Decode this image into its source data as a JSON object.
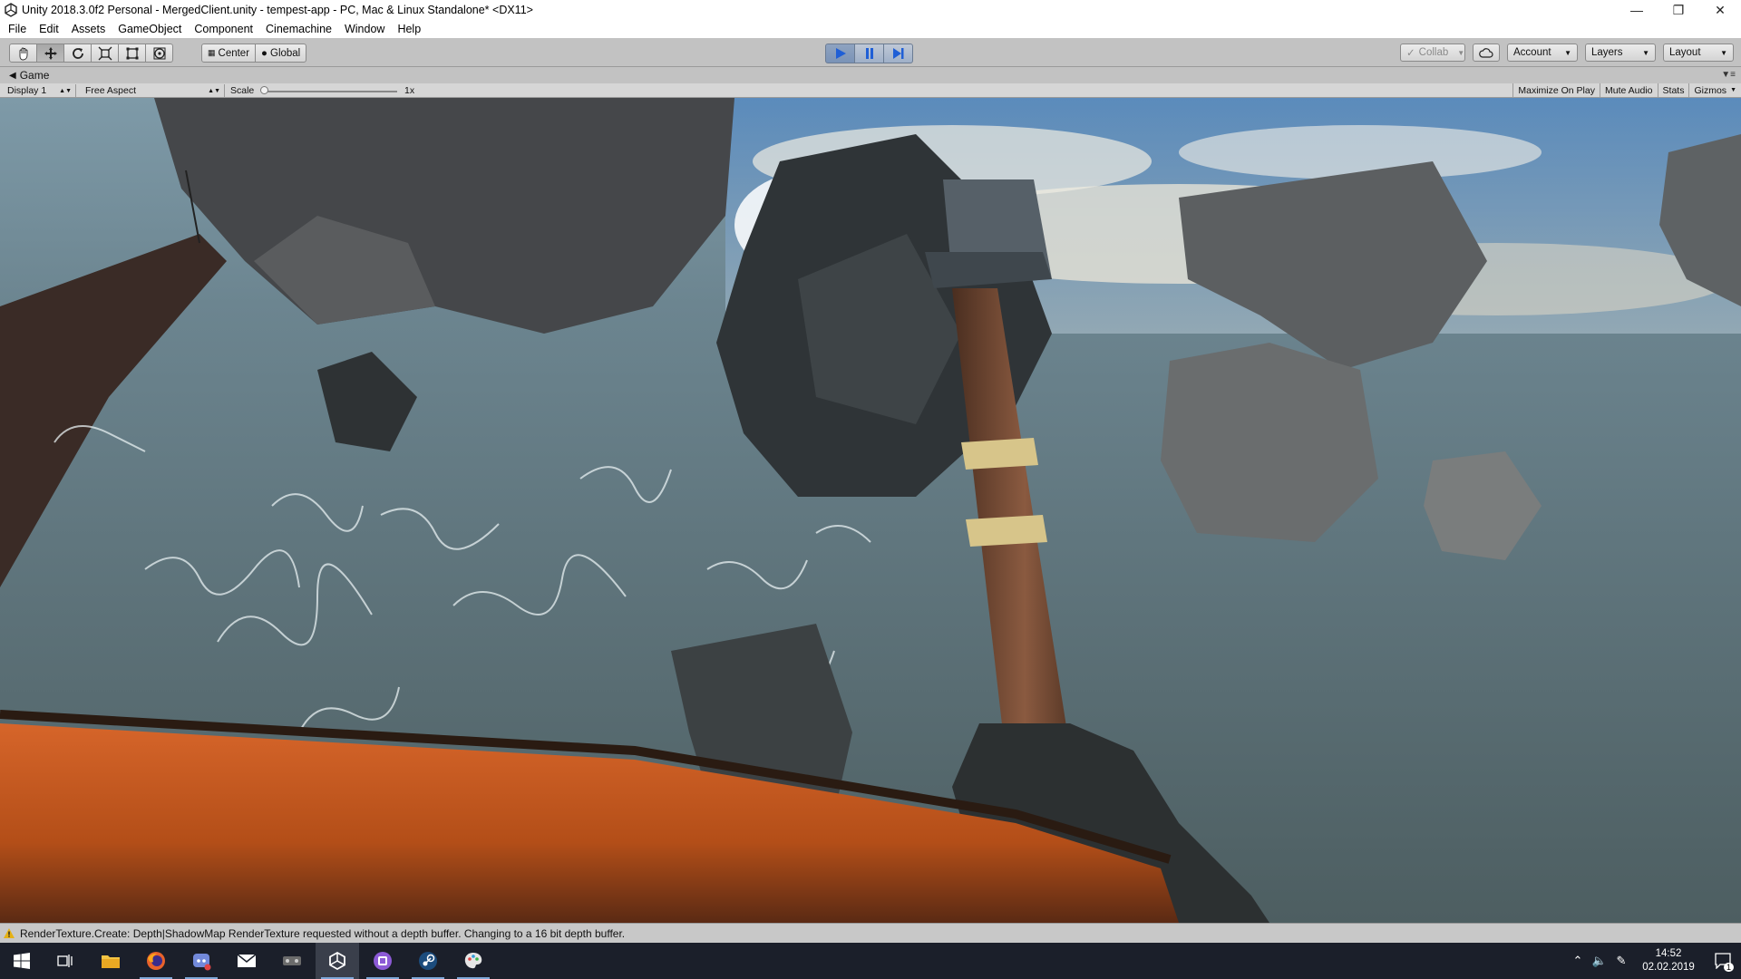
{
  "window": {
    "title": "Unity 2018.3.0f2 Personal - MergedClient.unity - tempest-app - PC, Mac & Linux Standalone* <DX11>",
    "controls": [
      "minimize-icon",
      "restore-icon",
      "close-icon"
    ]
  },
  "menu": [
    "File",
    "Edit",
    "Assets",
    "GameObject",
    "Component",
    "Cinemachine",
    "Window",
    "Help"
  ],
  "toolbar": {
    "tools": [
      "hand-tool-icon",
      "move-tool-icon",
      "rotate-tool-icon",
      "scale-tool-icon",
      "rect-tool-icon",
      "transform-tool-icon"
    ],
    "active_tool_index": 1,
    "pivot_label": "Center",
    "space_label": "Global",
    "play_state": "playing",
    "collab_label": "Collab",
    "account_label": "Account",
    "layers_label": "Layers",
    "layout_label": "Layout"
  },
  "game_view": {
    "tab_label": "Game",
    "display_label": "Display 1",
    "aspect_label": "Free Aspect",
    "scale_label": "Scale",
    "scale_value": "1x",
    "maximize_label": "Maximize On Play",
    "mute_label": "Mute Audio",
    "stats_label": "Stats",
    "gizmos_label": "Gizmos"
  },
  "console": {
    "message": "RenderTexture.Create: Depth|ShadowMap RenderTexture requested without a depth buffer. Changing to a 16 bit depth buffer."
  },
  "taskbar": {
    "apps": [
      "windows-start-icon",
      "task-view-icon",
      "file-explorer-icon",
      "firefox-icon",
      "discord-icon",
      "mail-icon",
      "game-app-icon",
      "unity-icon",
      "twitch-icon",
      "steam-icon",
      "paint-icon"
    ],
    "time": "14:52",
    "date": "02.02.2019",
    "notification_count": "1"
  },
  "colors": {
    "toolbar_bg": "#c2c2c2",
    "play_active": "#7a93b7",
    "taskbar_bg": "#1b1f2a",
    "sky": "#5d6f73",
    "ship_hull": "#c4581e"
  }
}
